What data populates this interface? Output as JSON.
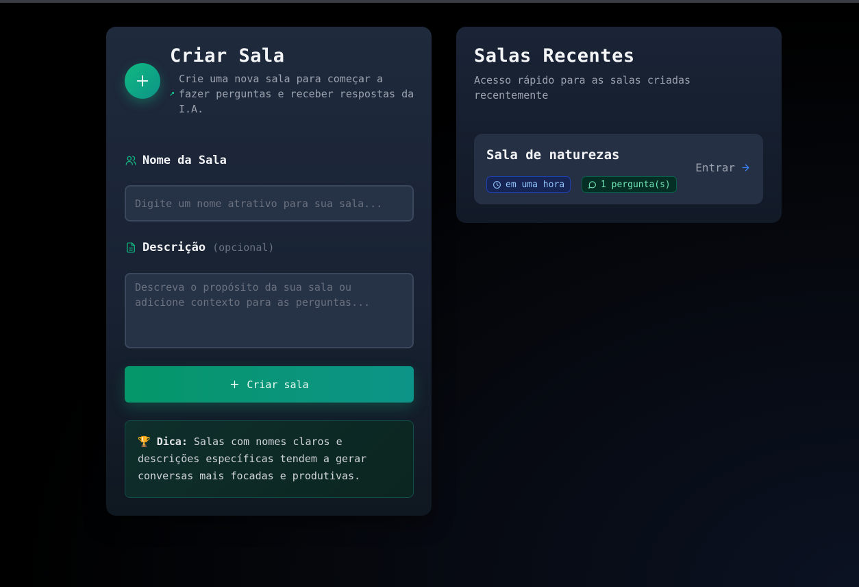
{
  "create": {
    "title": "Criar Sala",
    "subtitle": "Crie uma nova sala para começar a fazer perguntas e receber respostas da I.A.",
    "name_label": "Nome da Sala",
    "name_placeholder": "Digite um nome atrativo para sua sala...",
    "name_value": "",
    "desc_label": "Descrição",
    "desc_optional": "(opcional)",
    "desc_placeholder": "Descreva o propósito da sua sala ou adicione contexto para as perguntas...",
    "desc_value": "",
    "submit_label": "Criar sala",
    "tip_emoji": "🏆",
    "tip_title": "Dica:",
    "tip_text": "Salas com nomes claros e descrições específicas tendem a gerar conversas mais focadas e produtivas."
  },
  "recent": {
    "title": "Salas Recentes",
    "subtitle": "Acesso rápido para as salas criadas recentemente",
    "rooms": [
      {
        "name": "Sala de naturezas",
        "time_badge": "em uma hora",
        "questions_badge": "1 pergunta(s)",
        "enter_label": "Entrar"
      }
    ]
  },
  "icons": {
    "plus": "plus-icon",
    "users": "users-icon",
    "document": "file-text-icon",
    "clock": "clock-icon",
    "message": "message-circle-icon",
    "arrow": "arrow-right-icon"
  },
  "colors": {
    "accent": "#10b981",
    "accent_dark": "#0d9488",
    "badge_blue": "#93c5fd",
    "badge_green": "#6ee7b7"
  }
}
